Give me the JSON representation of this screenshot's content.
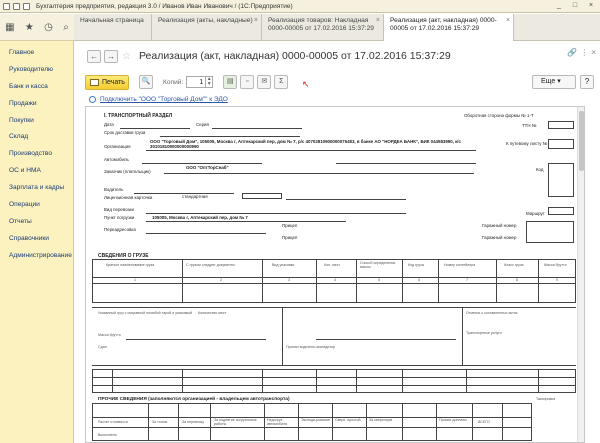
{
  "window": {
    "title": "Бухгалтерия предприятия, редакция 3.0 / Иванов Иван Иванович / (1С:Предприятие)",
    "win_buttons": [
      "_",
      "□",
      "×"
    ]
  },
  "left_nav": {
    "items": [
      "Главное",
      "Руководителю",
      "Банк и касса",
      "Продажи",
      "Покупки",
      "Склад",
      "Производство",
      "ОС и НМА",
      "Зарплата и кадры",
      "Операции",
      "Отчеты",
      "Справочники",
      "Администрирование"
    ]
  },
  "tabs": [
    {
      "label": "Начальная страница"
    },
    {
      "label": "Реализация (акты, накладные)"
    },
    {
      "label": "Реализация товаров: Накладная 0000-00005 от 17.02.2016 15:37:29"
    },
    {
      "label": "Реализация (акт, накладная) 0000-00005 от 17.02.2016 15:37:29"
    }
  ],
  "header": {
    "title": "Реализация (акт, накладная) 0000-00005 от 17.02.2016 15:37:29"
  },
  "toolbar": {
    "print_label": "Печать",
    "copies_label": "Копий:",
    "copies_value": "1",
    "more_label": "Еще",
    "help_label": "?"
  },
  "edo_link": "Подключить \"ООО \"Торговый Дом\"\" к ЭДО",
  "form": {
    "section1": "I. ТРАНСПОРТНЫЙ РАЗДЕЛ",
    "form_code": "Оборотная сторона формы № 1-Т",
    "ttn": "ТТН №",
    "fields": [
      "Дата",
      "Серия",
      "Срок доставки груза",
      "Организация",
      "Автомобиль",
      "Заказчик (плательщик)",
      "Водитель",
      "Лицензионная карточка",
      "Вид перевозки",
      "Пункт погрузки",
      "Переадресовка",
      "Прицеп",
      "Прицеп"
    ],
    "org_text": "ООО \"Торговый Дом\", 105005, Москва г, Аптекарский пер, дом № 7, р/с 40702810900000075483, в банке АО \"НОРДЕА БАНК\", БИК 044583990, к/с 30101810900000000990",
    "customer_text": "ООО \"ОптТорСнаб\"",
    "license_text": "стандартная",
    "load_point": "105005, Москва г, Аптекарский пер, дом № 7",
    "right_labels": [
      "К путевому листу №",
      "Код",
      "Маршрут",
      "Гаражный номер",
      "Гаражный номер"
    ],
    "section2": "СВЕДЕНИЯ О ГРУЗЕ",
    "cargo_headers": [
      "Краткое наименование груза",
      "С грузом следуют документы",
      "Вид упаковки",
      "Кол. мест",
      "Способ определения массы",
      "Код груза",
      "Номер контейнера",
      "Класс груза",
      "Масса брутто"
    ],
    "cargo_numbers": [
      "1",
      "2",
      "3",
      "4",
      "5",
      "6",
      "7",
      "8",
      "9"
    ],
    "misc": [
      "Указанный груз с исправной пломбой тарой и упаковкой",
      "Количество мест",
      "Масса брутто",
      "Сдал",
      "Принял водитель-экспедитор",
      "Отметки о составленных актах",
      "Транспортные услуги"
    ],
    "section3": "ПРОЧИЕ СВЕДЕНИЯ (заполняются организацией - владельцем автотранспорта)",
    "taxation": "Таксировка",
    "ops_headers": [
      "Расчет стоимости",
      "За тонны",
      "За перевозку",
      "За поднятие погрузочные работы",
      "Недогруз автомобиля",
      "Экспеди-рование",
      "Сверх. простой",
      "За сверхнорм",
      "Прочие доплаты",
      "ВСЕГО"
    ],
    "ops_footer": "Выполнено"
  }
}
